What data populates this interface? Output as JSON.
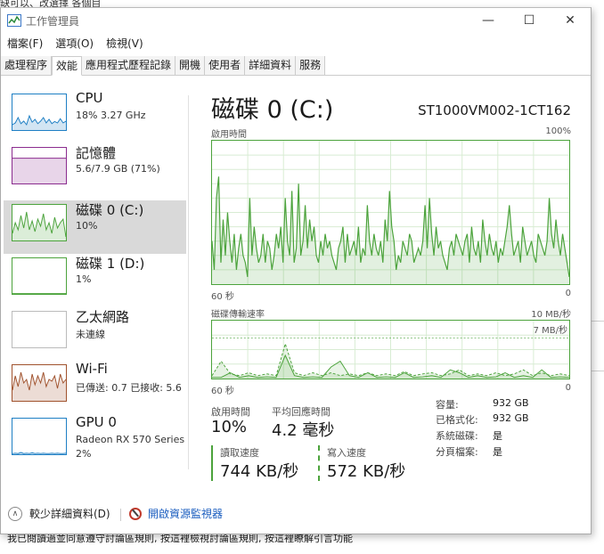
{
  "background": {
    "top_text": "缺可以、改選擇 各個目",
    "bottom_text": "我已閱讀過並同意遵守討論區規則,",
    "bottom_link1": "按這裡檢視討論區規則,",
    "bottom_link2": "按這裡瞭解引言功能"
  },
  "window": {
    "title": "工作管理員",
    "controls": {
      "minimize": "—",
      "maximize": "☐",
      "close": "✕"
    }
  },
  "menu": [
    "檔案(F)",
    "選項(O)",
    "檢視(V)"
  ],
  "tabs": [
    "處理程序",
    "效能",
    "應用程式歷程記錄",
    "開機",
    "使用者",
    "詳細資料",
    "服務"
  ],
  "active_tab": "效能",
  "resources": [
    {
      "name": "CPU",
      "line1": "18%  3.27 GHz",
      "line2": "",
      "color": "#1e7fc4",
      "series": [
        0.15,
        0.2,
        0.35,
        0.18,
        0.25,
        0.15,
        0.4,
        0.22,
        0.3,
        0.18,
        0.25,
        0.35,
        0.2,
        0.3,
        0.18,
        0.24,
        0.2,
        0.32,
        0.2,
        0.25
      ]
    },
    {
      "name": "記憶體",
      "line1": "5.6/7.9 GB (71%)",
      "line2": "",
      "color": "#8b2c8f",
      "series": [
        0.71,
        0.71,
        0.71,
        0.71,
        0.71,
        0.71,
        0.71,
        0.71,
        0.71,
        0.71,
        0.71,
        0.71,
        0.71,
        0.71,
        0.71,
        0.71,
        0.71,
        0.71,
        0.71,
        0.71
      ]
    },
    {
      "name": "磁碟 0 (C:)",
      "line1": "10%",
      "line2": "",
      "color": "#4ca33c",
      "series": [
        0.2,
        0.5,
        0.3,
        0.7,
        0.35,
        0.8,
        0.3,
        0.55,
        0.25,
        0.6,
        0.4,
        0.75,
        0.3,
        0.5,
        0.2,
        0.65,
        0.35,
        0.5,
        0.6,
        0.1
      ]
    },
    {
      "name": "磁碟 1 (D:)",
      "line1": "1%",
      "line2": "",
      "color": "#4ca33c",
      "series": [
        0.01,
        0.01,
        0.01,
        0.01,
        0.01,
        0.01,
        0.01,
        0.01,
        0.01,
        0.01,
        0.01,
        0.01,
        0.01,
        0.01,
        0.01,
        0.01,
        0.01,
        0.01,
        0.01,
        0.01
      ]
    },
    {
      "name": "乙太網路",
      "line1": "未連線",
      "line2": "",
      "color": "#bbbbbb",
      "series": []
    },
    {
      "name": "Wi-Fi",
      "line1": "已傳送: 0.7  已接收: 5.6",
      "line2": "",
      "color": "#a0522d",
      "series": [
        0.3,
        0.7,
        0.4,
        0.8,
        0.5,
        0.6,
        0.3,
        0.75,
        0.45,
        0.7,
        0.5,
        0.8,
        0.4,
        0.6,
        0.55,
        0.7,
        0.35,
        0.75,
        0.5,
        0.6
      ]
    },
    {
      "name": "GPU 0",
      "line1": "Radeon RX 570 Series",
      "line2": "2%",
      "color": "#1e7fc4",
      "series": [
        0.02,
        0.03,
        0.02,
        0.05,
        0.02,
        0.03,
        0.02,
        0.04,
        0.02,
        0.03,
        0.02,
        0.03,
        0.02,
        0.02,
        0.03,
        0.02,
        0.03,
        0.02,
        0.02,
        0.03
      ]
    }
  ],
  "active_resource": 2,
  "detail": {
    "title": "磁碟 0 (C:)",
    "model": "ST1000VM002-1CT162",
    "active_time_caption": "啟用時間",
    "active_time_max": "100%",
    "axis_left": "60 秒",
    "axis_right": "0",
    "transfer_caption": "磁碟傳輸速率",
    "transfer_max": "10 MB/秒",
    "transfer_mid": "7 MB/秒",
    "active_time_series": [
      0.3,
      0.1,
      0.6,
      0.75,
      0.15,
      0.45,
      0.2,
      0.5,
      0.3,
      0.15,
      0.35,
      0.1,
      0.25,
      0.35,
      0.2,
      0.15,
      0.05,
      0.6,
      0.2,
      0.4,
      0.25,
      0.15,
      0.2,
      0.35,
      0.15,
      0.3,
      0.25,
      0.1,
      0.2,
      0.35,
      0.25,
      0.4,
      0.15,
      0.6,
      0.3,
      0.2,
      0.65,
      0.15,
      0.25,
      0.7,
      0.2,
      0.3,
      0.55,
      0.25,
      0.45,
      0.3,
      0.4,
      0.2,
      0.15,
      0.3,
      0.2,
      0.35,
      0.25,
      0.3,
      0.2,
      0.15,
      0.1,
      0.25,
      0.3,
      0.4,
      0.15,
      0.35,
      0.2,
      0.25,
      0.3,
      0.2,
      0.4,
      0.15,
      0.25,
      0.2,
      0.55,
      0.3,
      0.2,
      0.35,
      0.25,
      0.2,
      0.3,
      0.15,
      0.45,
      0.3,
      0.65,
      0.4,
      0.3,
      0.1,
      0.2,
      0.15,
      0.3,
      0.25,
      0.2,
      0.35,
      0.3,
      0.15,
      0.2,
      0.25,
      0.2,
      0.3,
      0.55,
      0.25,
      0.6,
      0.35,
      0.2,
      0.4,
      0.25,
      0.3,
      0.2,
      0.15,
      0.1,
      0.25,
      0.3,
      0.2,
      0.35,
      0.3,
      0.25,
      0.2,
      0.3,
      0.35,
      0.15,
      0.4,
      0.25,
      0.2,
      0.3,
      0.15,
      0.45,
      0.3,
      0.2,
      0.35,
      0.25,
      0.2,
      0.3,
      0.15,
      0.25,
      0.2,
      0.3,
      0.4,
      0.55,
      0.35,
      0.2,
      0.25,
      0.3,
      0.15,
      0.4,
      0.3,
      0.2,
      0.25,
      0.3,
      0.2,
      0.15,
      0.35,
      0.3,
      0.25,
      0.2,
      0.3,
      0.6,
      0.35,
      0.25,
      0.45,
      0.3,
      0.2,
      0.35,
      0.25,
      0.15,
      0.05
    ],
    "read_series": [
      0.02,
      0.02,
      0.1,
      0.02,
      0.05,
      0.02,
      0.03,
      0.02,
      0.4,
      0.05,
      0.02,
      0.03,
      0.02,
      0.2,
      0.3,
      0.05,
      0.02,
      0.1,
      0.02,
      0.03,
      0.02,
      0.1,
      0.02,
      0.03,
      0.05,
      0.02,
      0.15,
      0.1,
      0.02,
      0.05,
      0.02,
      0.03,
      0.1,
      0.02,
      0.05,
      0.02,
      0.15,
      0.02,
      0.03,
      0.02
    ],
    "write_series": [
      0.05,
      0.3,
      0.08,
      0.05,
      0.1,
      0.05,
      0.08,
      0.05,
      0.6,
      0.1,
      0.05,
      0.1,
      0.05,
      0.1,
      0.05,
      0.08,
      0.05,
      0.1,
      0.05,
      0.08,
      0.05,
      0.12,
      0.05,
      0.08,
      0.1,
      0.05,
      0.08,
      0.15,
      0.05,
      0.08,
      0.05,
      0.1,
      0.05,
      0.08,
      0.15,
      0.05,
      0.1,
      0.05,
      0.08,
      0.05
    ],
    "stats": {
      "active_time_label": "啟用時間",
      "active_time_value": "10%",
      "avg_response_label": "平均回應時間",
      "avg_response_value": "4.2 毫秒",
      "read_label": "讀取速度",
      "read_value": "744 KB/秒",
      "write_label": "寫入速度",
      "write_value": "572 KB/秒"
    },
    "properties": [
      {
        "label": "容量:",
        "value": "932 GB"
      },
      {
        "label": "已格式化:",
        "value": "932 GB"
      },
      {
        "label": "系統磁碟:",
        "value": "是"
      },
      {
        "label": "分頁檔案:",
        "value": "是"
      }
    ]
  },
  "footer": {
    "fewer_details": "較少詳細資料(D)",
    "open_monitor": "開啟資源監視器"
  }
}
